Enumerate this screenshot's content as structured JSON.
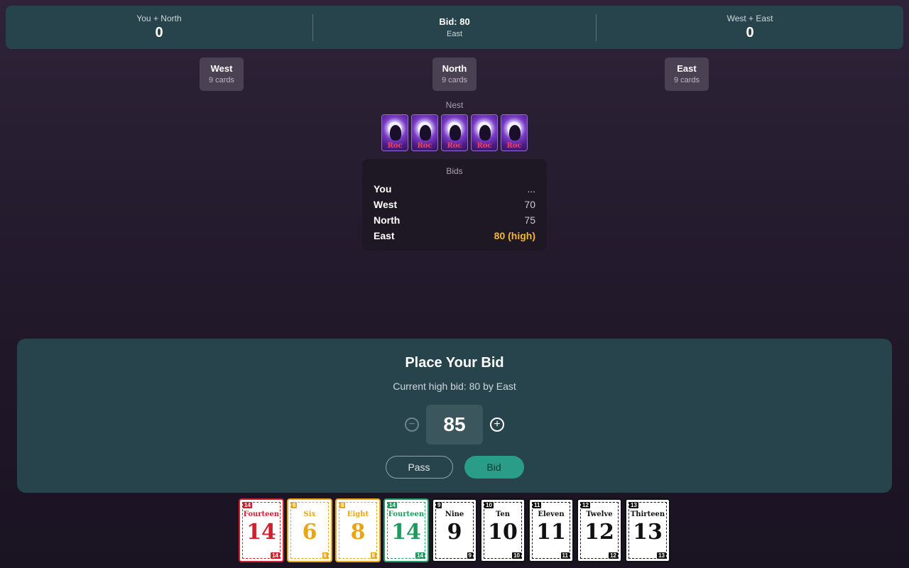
{
  "scoreboard": {
    "team1": {
      "label": "You + North",
      "score": "0"
    },
    "current_bid": {
      "label": "Bid: 80",
      "bidder": "East"
    },
    "team2": {
      "label": "West + East",
      "score": "0"
    }
  },
  "players": [
    {
      "name": "West",
      "cards": "9 cards"
    },
    {
      "name": "North",
      "cards": "9 cards"
    },
    {
      "name": "East",
      "cards": "9 cards"
    }
  ],
  "nest": {
    "label": "Nest",
    "card_back_text": "Roc",
    "count": 5
  },
  "bids": {
    "title": "Bids",
    "rows": [
      {
        "name": "You",
        "value": "...",
        "high": false
      },
      {
        "name": "West",
        "value": "70",
        "high": false
      },
      {
        "name": "North",
        "value": "75",
        "high": false
      },
      {
        "name": "East",
        "value": "80 (high)",
        "high": true
      }
    ]
  },
  "dialog": {
    "title": "Place Your Bid",
    "subtitle": "Current high bid: 80 by East",
    "amount": "85",
    "minus_icon": "minus-circle-icon",
    "plus_icon": "plus-circle-icon",
    "pass_label": "Pass",
    "bid_label": "Bid"
  },
  "colors": {
    "red": "#d0202e",
    "yellow": "#e8a616",
    "green": "#1f9a5e",
    "black": "#111111",
    "accent": "#2a9d88",
    "high": "#f2b632"
  },
  "hand": [
    {
      "name": "Fourteen",
      "number": "14",
      "color": "red"
    },
    {
      "name": "Six",
      "number": "6",
      "color": "yellow"
    },
    {
      "name": "Eight",
      "number": "8",
      "color": "yellow"
    },
    {
      "name": "Fourteen",
      "number": "14",
      "color": "green"
    },
    {
      "name": "Nine",
      "number": "9",
      "color": "black"
    },
    {
      "name": "Ten",
      "number": "10",
      "color": "black"
    },
    {
      "name": "Eleven",
      "number": "11",
      "color": "black"
    },
    {
      "name": "Twelve",
      "number": "12",
      "color": "black"
    },
    {
      "name": "Thirteen",
      "number": "13",
      "color": "black"
    }
  ]
}
